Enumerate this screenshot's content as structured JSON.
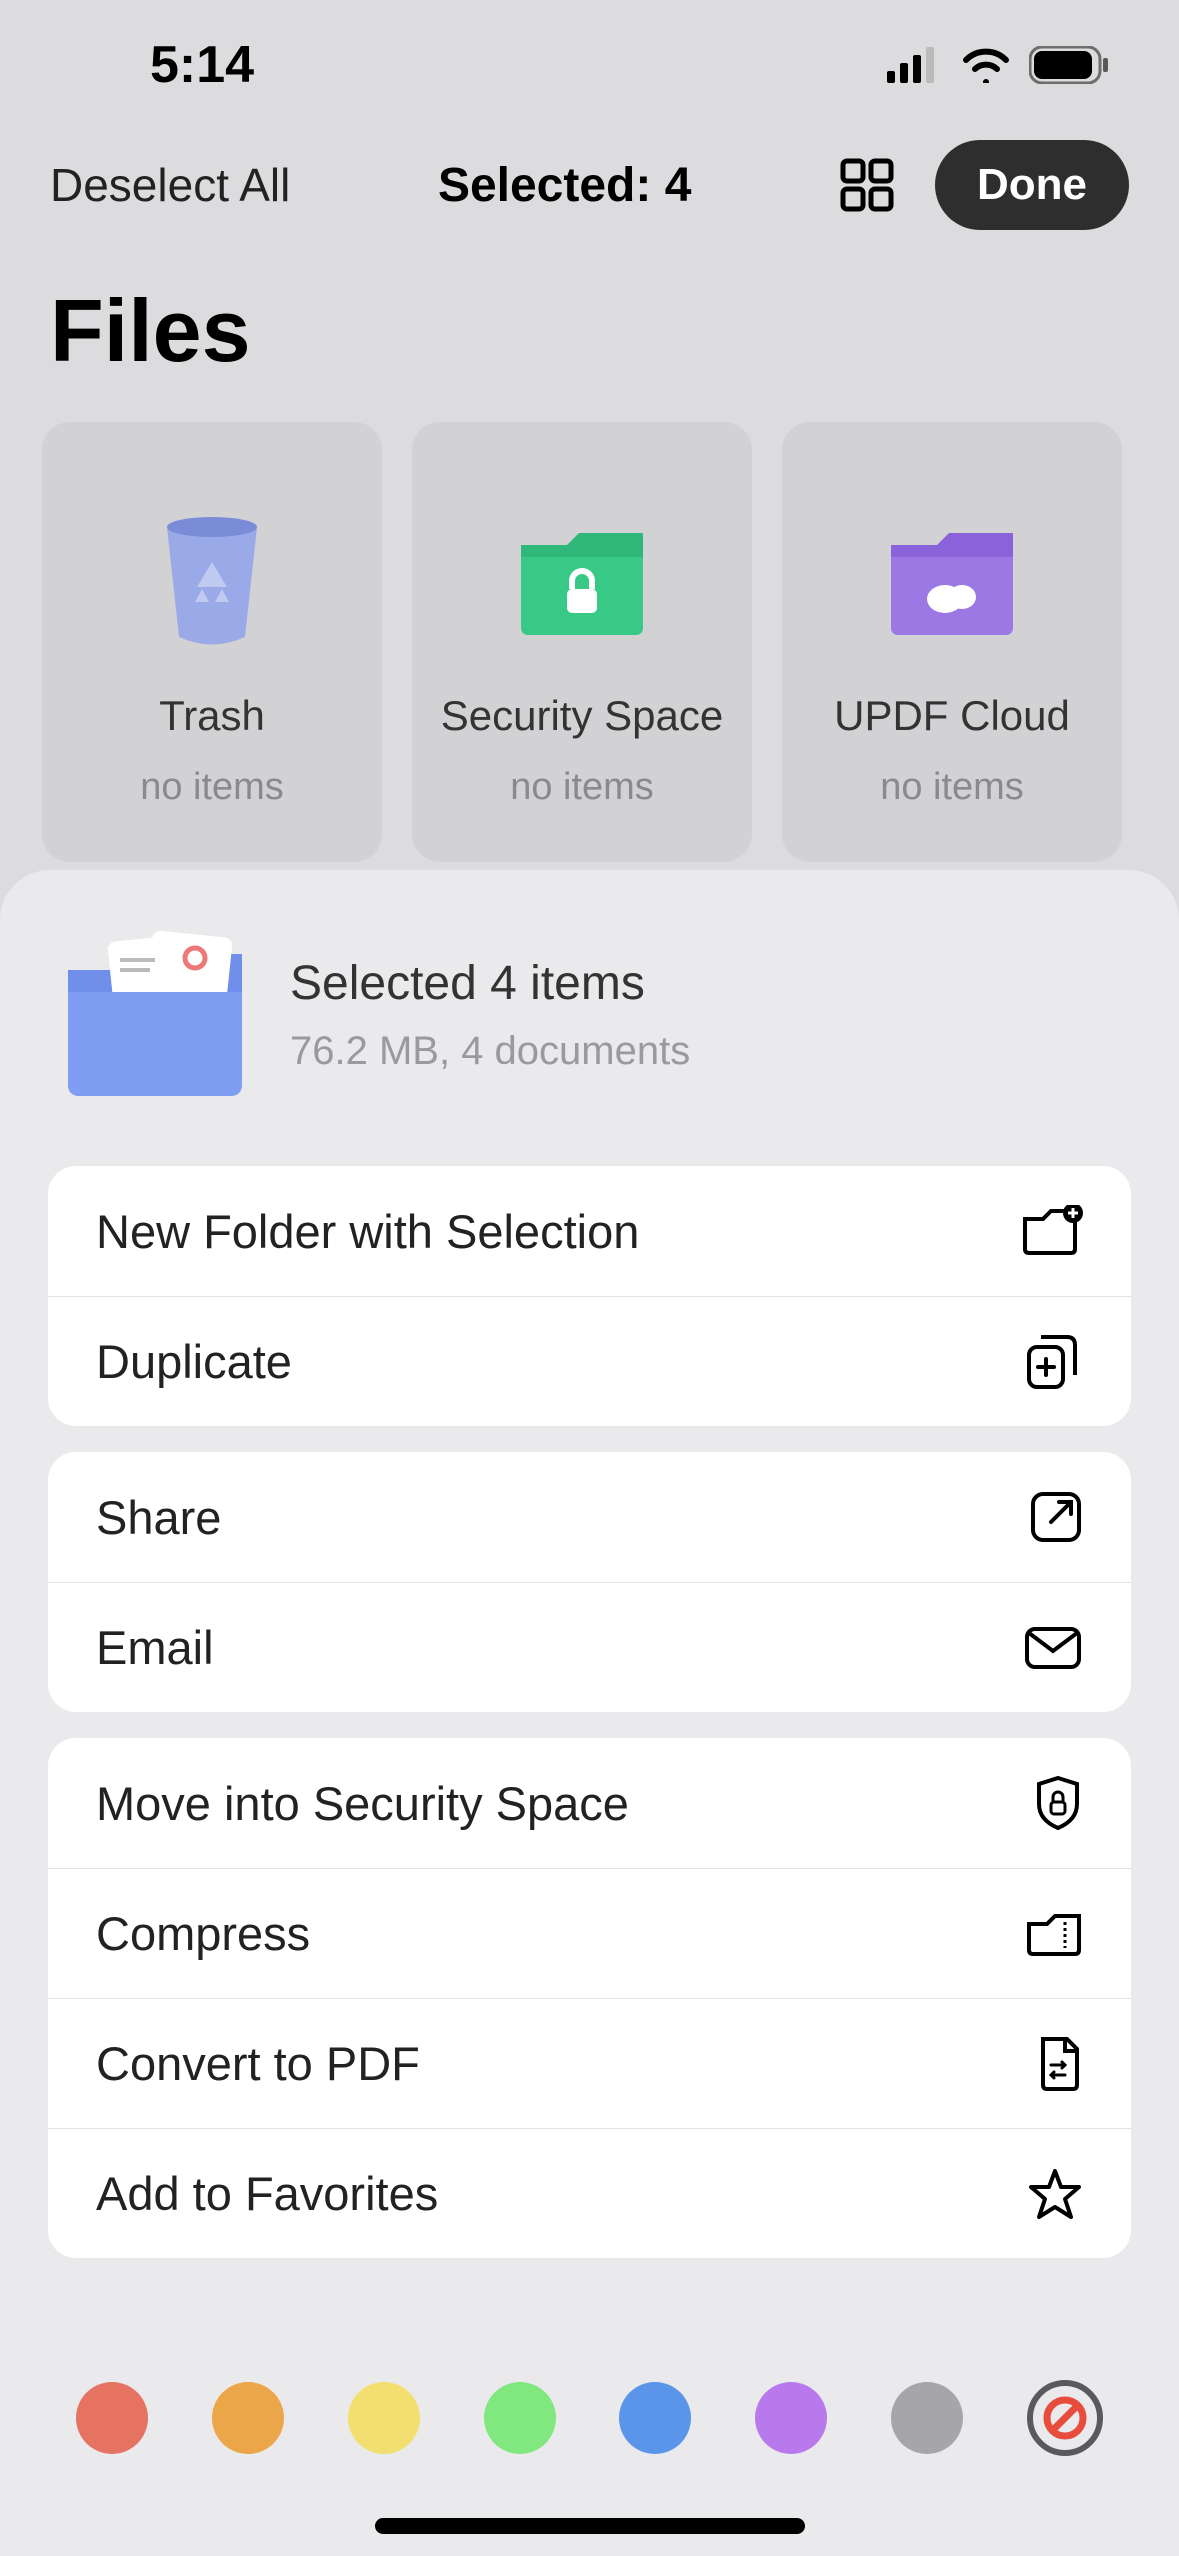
{
  "status": {
    "time": "5:14"
  },
  "nav": {
    "deselect": "Deselect All",
    "selected": "Selected: 4",
    "done": "Done"
  },
  "page_title": "Files",
  "tiles": [
    {
      "name": "Trash",
      "sub": "no items"
    },
    {
      "name": "Security Space",
      "sub": "no items"
    },
    {
      "name": "UPDF Cloud",
      "sub": "no items"
    }
  ],
  "sheet": {
    "title": "Selected 4 items",
    "sub": "76.2 MB, 4 documents"
  },
  "actions": {
    "g1": [
      {
        "label": "New Folder with Selection"
      },
      {
        "label": "Duplicate"
      }
    ],
    "g2": [
      {
        "label": "Share"
      },
      {
        "label": "Email"
      }
    ],
    "g3": [
      {
        "label": "Move into Security Space"
      },
      {
        "label": "Compress"
      },
      {
        "label": "Convert to PDF"
      },
      {
        "label": "Add to Favorites"
      }
    ]
  },
  "colors": [
    "#e67362",
    "#eba64a",
    "#f2df6f",
    "#81e87f",
    "#5a95ea",
    "#b879ec",
    "#a6a6aa"
  ]
}
